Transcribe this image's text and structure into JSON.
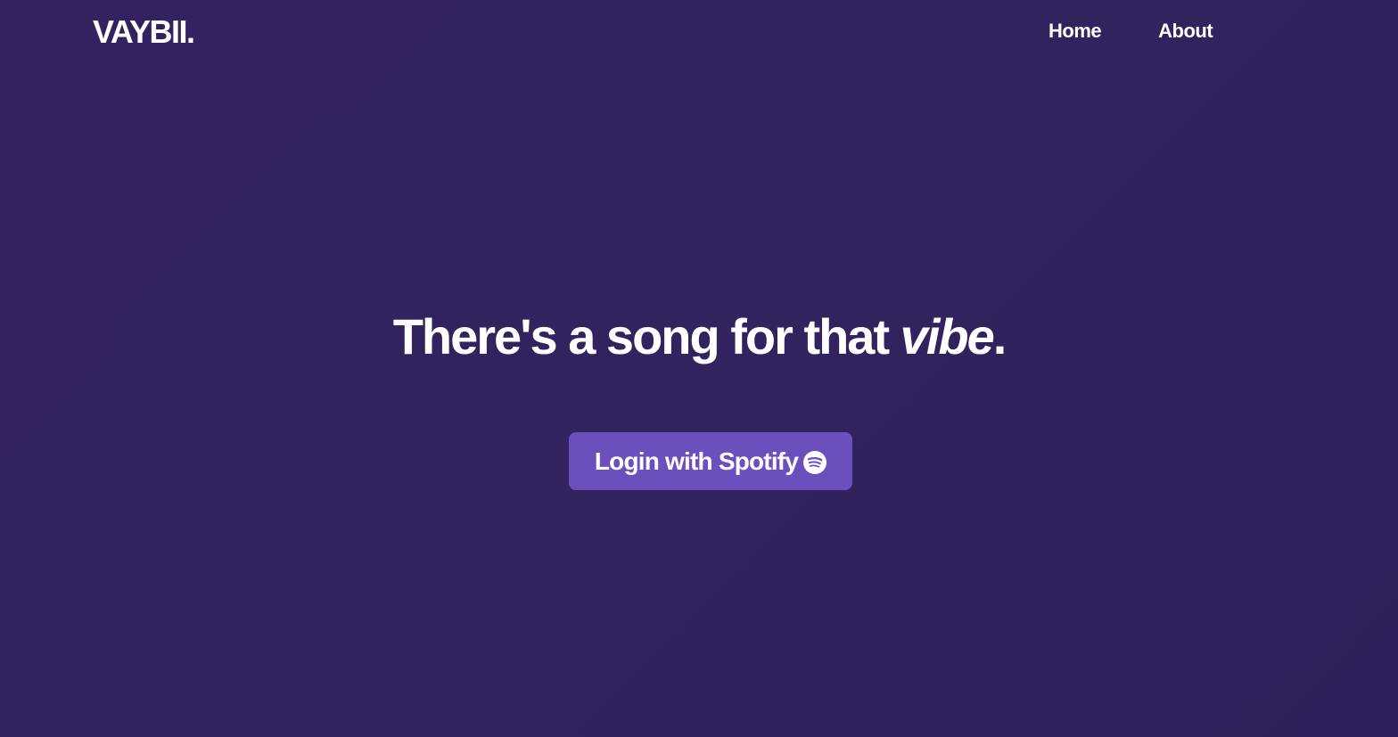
{
  "header": {
    "logo": "VAYBII.",
    "nav": [
      {
        "label": "Home"
      },
      {
        "label": "About"
      }
    ]
  },
  "hero": {
    "headline_prefix": "There's a song for that ",
    "headline_emphasis": "vibe",
    "headline_suffix": "."
  },
  "cta": {
    "label": "Login with Spotify",
    "icon": "spotify-icon"
  },
  "colors": {
    "background": "#32225e",
    "button": "#6b4fbd",
    "text": "#ffffff"
  }
}
